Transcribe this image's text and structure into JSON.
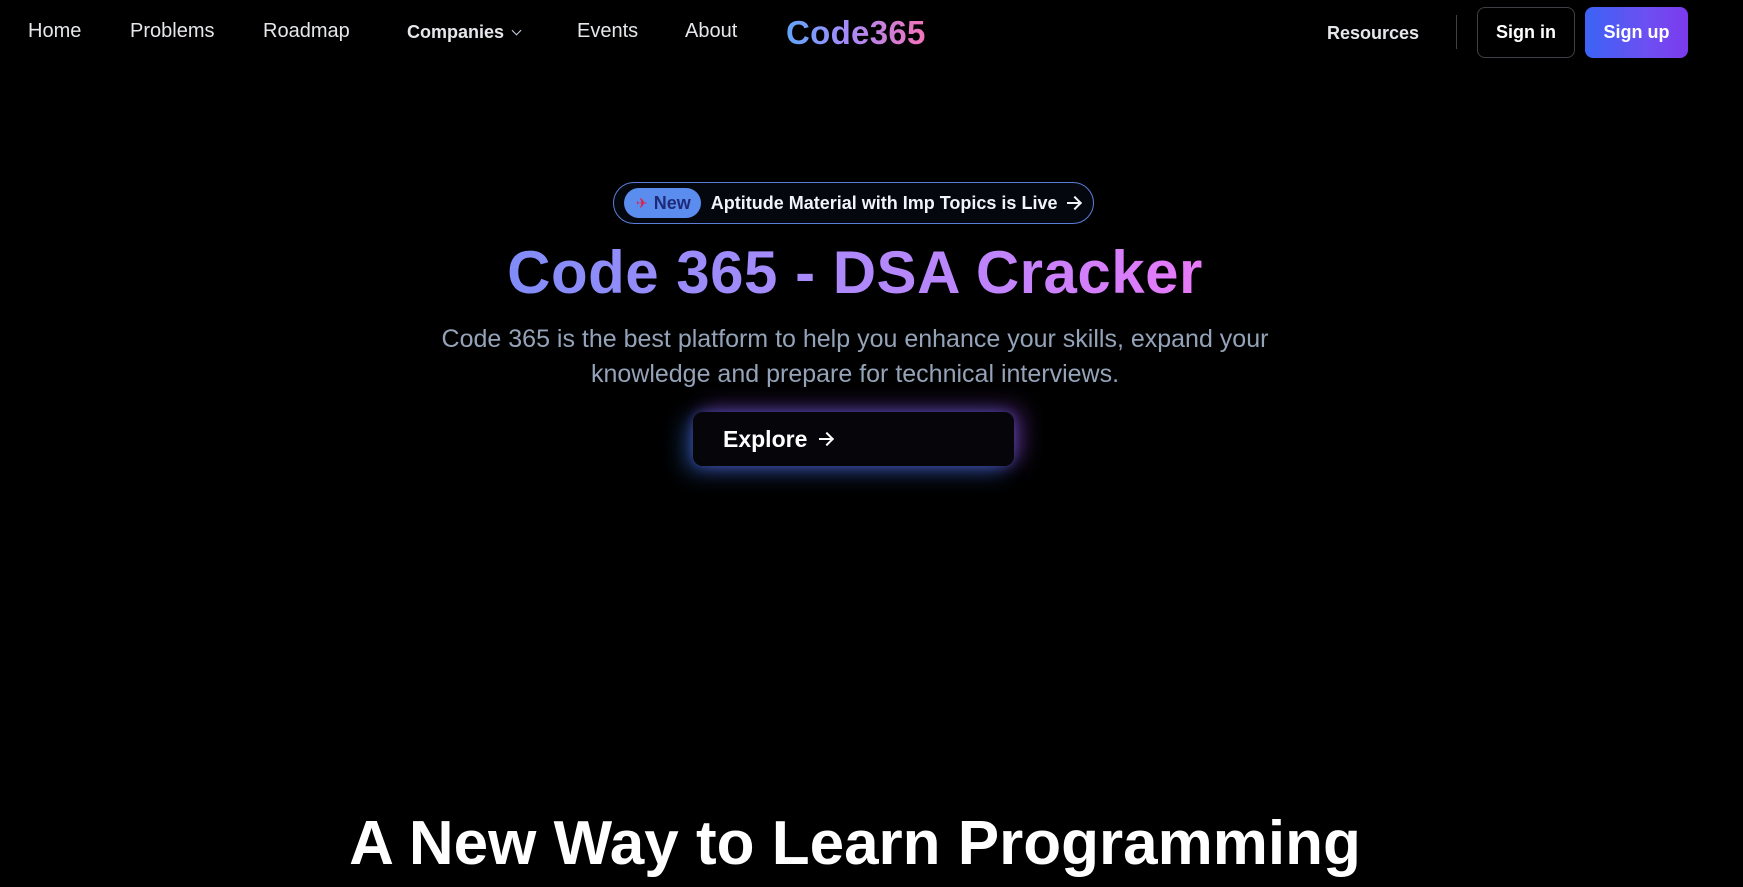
{
  "nav": {
    "links": {
      "home": "Home",
      "problems": "Problems",
      "roadmap": "Roadmap",
      "companies": "Companies",
      "events": "Events",
      "about": "About"
    },
    "logo": "Code365",
    "resources": "Resources",
    "sign_in": "Sign in",
    "sign_up": "Sign up"
  },
  "hero": {
    "announcement": {
      "badge_icon": "rocket-icon",
      "badge_label": "New",
      "text": "Aptitude Material with Imp Topics is Live"
    },
    "title": "Code 365 - DSA Cracker",
    "subtitle": "Code 365 is the best platform to help you enhance your skills, expand your knowledge and prepare for technical interviews.",
    "explore_label": "Explore"
  },
  "section": {
    "title": "A New Way to Learn Programming"
  },
  "colors": {
    "background": "#000000",
    "accent_blue": "#3b63f5",
    "accent_purple": "#7c3aed",
    "gradient_start": "#818cf8",
    "gradient_end": "#e879f9"
  }
}
